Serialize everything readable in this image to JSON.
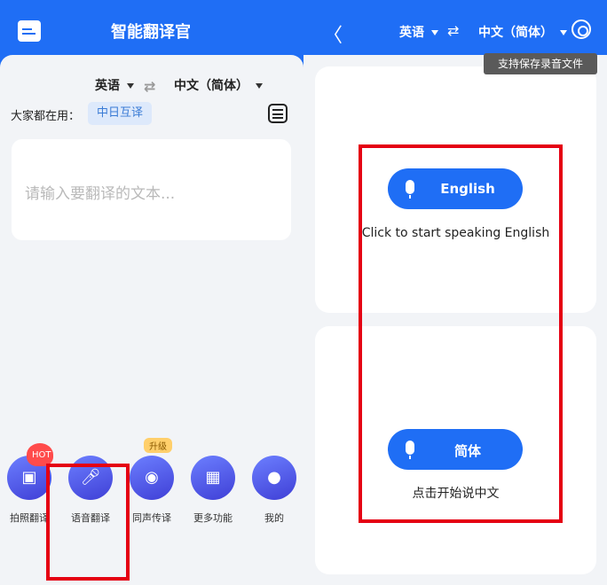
{
  "left": {
    "title": "智能翻译官",
    "source_lang": "英语",
    "target_lang": "中文（简体）",
    "common_label": "大家都在用：",
    "common_chip": "中日互译",
    "input_placeholder": "请输入要翻译的文本...",
    "nav": [
      {
        "label": "拍照翻译",
        "icon": "camera-icon",
        "badge": "HOT"
      },
      {
        "label": "语音翻译",
        "icon": "microphone-icon"
      },
      {
        "label": "同声传译",
        "icon": "speaker-person-icon",
        "badge": "升级"
      },
      {
        "label": "更多功能",
        "icon": "grid-icon"
      },
      {
        "label": "我的",
        "icon": "user-icon"
      }
    ]
  },
  "right": {
    "source_lang": "英语",
    "target_lang": "中文（简体）",
    "tooltip": "支持保存录音文件",
    "card1": {
      "button": "English",
      "hint": "Click to start speaking English"
    },
    "card2": {
      "button": "简体",
      "hint": "点击开始说中文"
    }
  },
  "colors": {
    "accent": "#1f6ef5",
    "highlight": "#e50012"
  }
}
